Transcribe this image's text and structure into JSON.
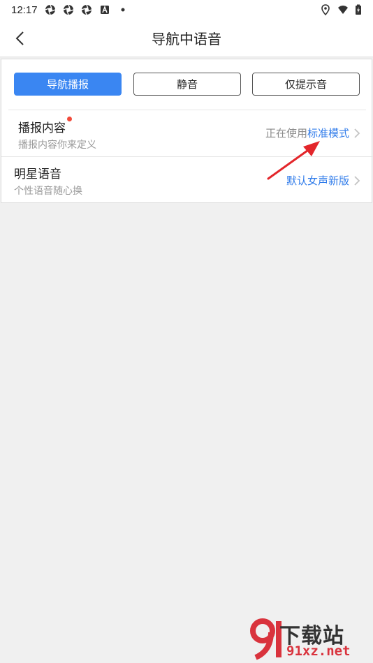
{
  "status_bar": {
    "time": "12:17",
    "left_icons": [
      "aperture-icon",
      "aperture-icon",
      "aperture-icon",
      "a-badge-icon",
      "dot-icon"
    ],
    "right_icons": [
      "location-icon",
      "wifi-icon",
      "battery-charging-icon"
    ]
  },
  "nav": {
    "title": "导航中语音",
    "back_icon": "chevron-left-icon"
  },
  "segments": [
    {
      "label": "导航播报",
      "active": true
    },
    {
      "label": "静音",
      "active": false
    },
    {
      "label": "仅提示音",
      "active": false
    }
  ],
  "rows": [
    {
      "title": "播报内容",
      "subtitle": "播报内容你来定义",
      "value_prefix": "正在使用",
      "value": "标准模式",
      "has_red_dot": true
    },
    {
      "title": "明星语音",
      "subtitle": "个性语音随心换",
      "value_prefix": "",
      "value": "默认女声新版",
      "has_red_dot": false
    }
  ],
  "watermark": {
    "logo_text": "下载站",
    "domain": "91xz.net"
  },
  "colors": {
    "accent": "#3a86f2",
    "link_value": "#2f7bea",
    "red_dot": "#f24a3a",
    "annotation_arrow": "#e3262b",
    "background": "#f0f0f0"
  }
}
